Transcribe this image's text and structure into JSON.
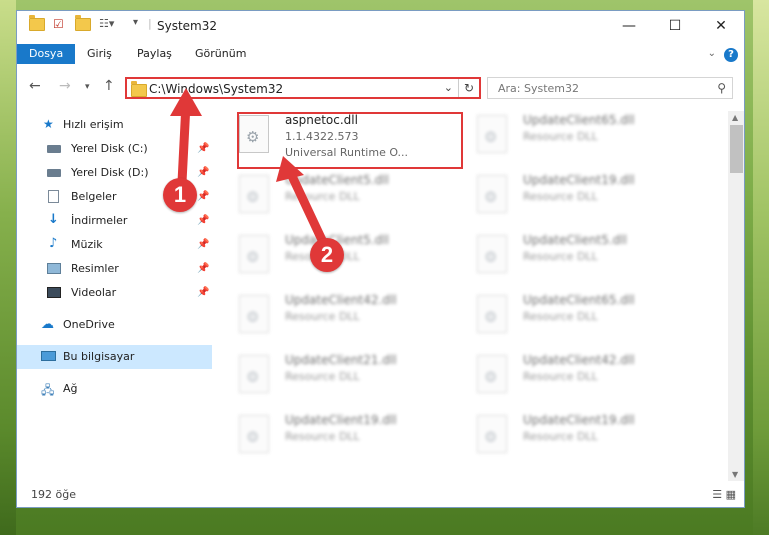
{
  "window": {
    "title": "System32",
    "controls": {
      "minimize": "—",
      "maximize": "☐",
      "close": "✕"
    }
  },
  "ribbon": {
    "tabs": [
      "Dosya",
      "Giriş",
      "Paylaş",
      "Görünüm"
    ],
    "help": "?"
  },
  "navigation": {
    "address": "C:\\Windows\\System32",
    "search_placeholder": "Ara: System32"
  },
  "sidebar": {
    "items": [
      {
        "label": "Hızlı erişim",
        "icon": "star-icon"
      },
      {
        "label": "Yerel Disk (C:)",
        "icon": "drive-icon",
        "pinned": true
      },
      {
        "label": "Yerel Disk (D:)",
        "icon": "drive-icon",
        "pinned": true
      },
      {
        "label": "Belgeler",
        "icon": "documents-icon",
        "pinned": true
      },
      {
        "label": "İndirmeler",
        "icon": "download-icon",
        "pinned": true
      },
      {
        "label": "Müzik",
        "icon": "music-icon",
        "pinned": true
      },
      {
        "label": "Resimler",
        "icon": "pictures-icon",
        "pinned": true
      },
      {
        "label": "Videolar",
        "icon": "videos-icon",
        "pinned": true
      },
      {
        "label": "OneDrive",
        "icon": "cloud-icon"
      },
      {
        "label": "Bu bilgisayar",
        "icon": "computer-icon",
        "selected": true
      },
      {
        "label": "Ağ",
        "icon": "network-icon"
      }
    ]
  },
  "files": [
    {
      "name": "aspnetoc.dll",
      "version": "1.1.4322.573",
      "desc": "Universal Runtime O..."
    },
    {
      "name": "UpdateClient65.dll",
      "desc": "Resource DLL"
    },
    {
      "name": "UpdateClient5.dll",
      "desc": "Resource DLL"
    },
    {
      "name": "UpdateClient19.dll",
      "desc": "Resource DLL"
    },
    {
      "name": "UpdateClient5.dll",
      "desc": "Resource DLL"
    },
    {
      "name": "UpdateClient5.dll",
      "desc": "Resource DLL"
    },
    {
      "name": "UpdateClient42.dll",
      "desc": "Resource DLL"
    },
    {
      "name": "UpdateClient65.dll",
      "desc": "Resource DLL"
    },
    {
      "name": "UpdateClient21.dll",
      "desc": "Resource DLL"
    },
    {
      "name": "UpdateClient42.dll",
      "desc": "Resource DLL"
    },
    {
      "name": "UpdateClient19.dll",
      "desc": "Resource DLL"
    },
    {
      "name": "UpdateClient19.dll",
      "desc": "Resource DLL"
    }
  ],
  "status": {
    "item_count": "192 öğe"
  },
  "callouts": [
    "1",
    "2"
  ],
  "colors": {
    "accent": "#1979ca",
    "highlight": "#e03838",
    "folder": "#f3c84b"
  }
}
